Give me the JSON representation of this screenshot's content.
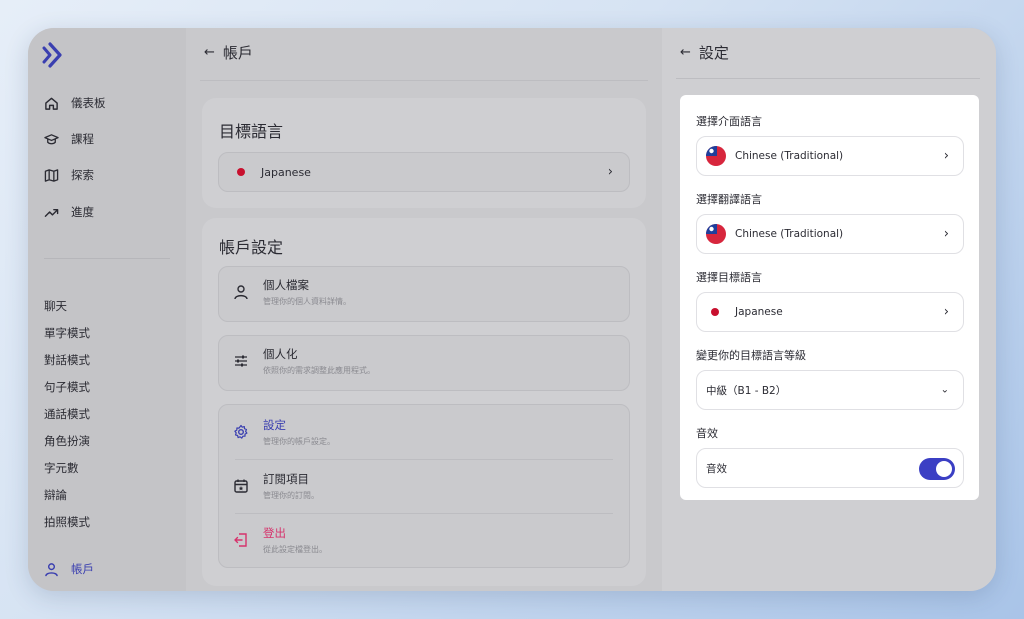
{
  "sidebar": {
    "nav": [
      {
        "label": "儀表板",
        "icon": "home-icon"
      },
      {
        "label": "課程",
        "icon": "graduation-cap-icon"
      },
      {
        "label": "探索",
        "icon": "map-icon"
      },
      {
        "label": "進度",
        "icon": "trend-up-icon"
      }
    ],
    "modes": [
      "聊天",
      "單字模式",
      "對話模式",
      "句子模式",
      "通話模式",
      "角色扮演",
      "字元數",
      "辯論",
      "拍照模式"
    ],
    "account_label": "帳戶"
  },
  "main": {
    "title": "帳戶",
    "target_card": {
      "title": "目標語言",
      "language": "Japanese"
    },
    "account_card": {
      "title": "帳戶設定",
      "profile": {
        "title": "個人檔案",
        "subtitle": "管理你的個人資料詳情。"
      },
      "personalize": {
        "title": "個人化",
        "subtitle": "依照你的需求調整此應用程式。"
      },
      "settings": {
        "title": "設定",
        "subtitle": "管理你的帳戶設定。"
      },
      "subscription": {
        "title": "訂閱項目",
        "subtitle": "管理你的訂閱。"
      },
      "logout": {
        "title": "登出",
        "subtitle": "從此設定檔登出。"
      }
    }
  },
  "settings_panel": {
    "title": "設定",
    "interface_label": "選擇介面語言",
    "interface_value": "Chinese (Traditional)",
    "translation_label": "選擇翻譯語言",
    "translation_value": "Chinese (Traditional)",
    "target_label": "選擇目標語言",
    "target_value": "Japanese",
    "level_label": "變更你的目標語言等級",
    "level_value": "中級（B1 - B2）",
    "sound_label": "音效",
    "sound_row_label": "音效",
    "sound_on": true
  },
  "colors": {
    "accent": "#3b3fc4",
    "logout": "#d6336c",
    "japan_dot": "#c8102e"
  }
}
